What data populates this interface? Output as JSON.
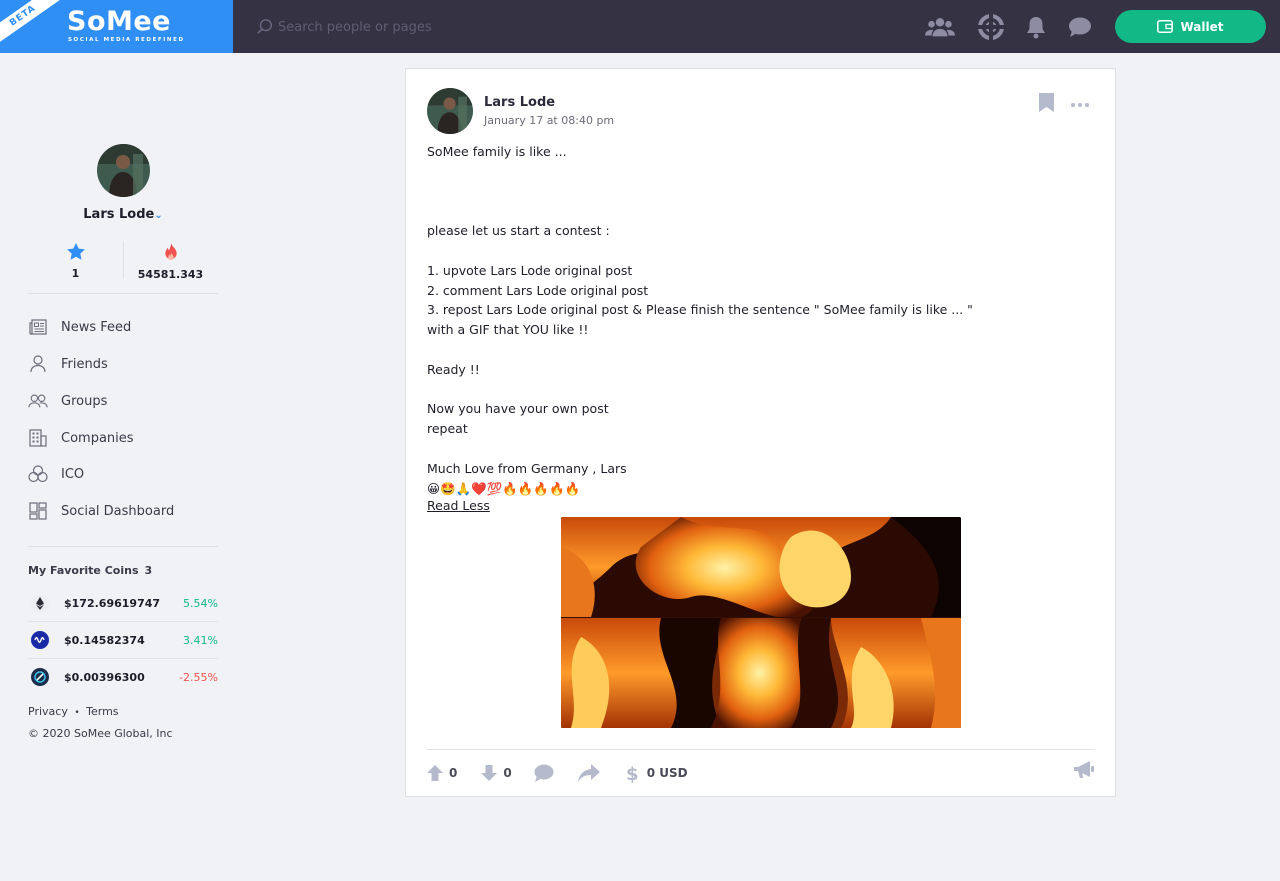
{
  "header": {
    "beta": "BETA",
    "logo": "SoMee",
    "tagline": "SOCIAL MEDIA REDEFINED",
    "search_placeholder": "Search people or pages",
    "wallet_label": "Wallet",
    "icons": [
      "groups-icon",
      "support-icon",
      "bell-icon",
      "chat-icon"
    ]
  },
  "profile": {
    "name": "Lars Lode",
    "caret": "⌄",
    "stars": "1",
    "points": "54581.343"
  },
  "nav": [
    {
      "label": "News Feed",
      "icon": "newspaper-icon"
    },
    {
      "label": "Friends",
      "icon": "user-icon"
    },
    {
      "label": "Groups",
      "icon": "group-icon"
    },
    {
      "label": "Companies",
      "icon": "building-icon"
    },
    {
      "label": "ICO",
      "icon": "coins-icon"
    },
    {
      "label": "Social Dashboard",
      "icon": "dashboard-icon"
    }
  ],
  "favorites": {
    "title": "My Favorite Coins",
    "count": "3",
    "coins": [
      {
        "price": "$172.69619747",
        "change": "5.54%",
        "color": "#12b886",
        "icon": "ethereum-icon"
      },
      {
        "price": "$0.14582374",
        "change": "3.41%",
        "color": "#12b886",
        "icon": "steem-icon"
      },
      {
        "price": "$0.00396300",
        "change": "-2.55%",
        "color": "#f0524f",
        "icon": "coin-icon"
      }
    ]
  },
  "footer": {
    "privacy": "Privacy",
    "dot": "•",
    "terms": "Terms",
    "copyright": "© 2020 SoMee Global, Inc"
  },
  "post": {
    "author": "Lars Lode",
    "time": "January 17 at 08:40 pm",
    "body": "SoMee family is like ...\n\n\n\nplease let us start a contest :\n\n1. upvote Lars Lode original post\n2. comment Lars Lode original post\n3. repost Lars Lode original post & Please finish the sentence \" SoMee family is like ... \"\nwith a GIF that YOU like !!\n\nReady !!\n\nNow you have your own post\nrepeat\n\nMuch Love from Germany , Lars\n😀🤩🙏❤️💯🔥🔥🔥🔥🔥",
    "read_less": "Read Less",
    "upvotes": "0",
    "downvotes": "0",
    "earnings": "0 USD"
  },
  "colors": {
    "accent": "#2f8ff5",
    "topbar": "#353244",
    "wallet": "#12b886",
    "action_icon": "#b5b9cc"
  }
}
